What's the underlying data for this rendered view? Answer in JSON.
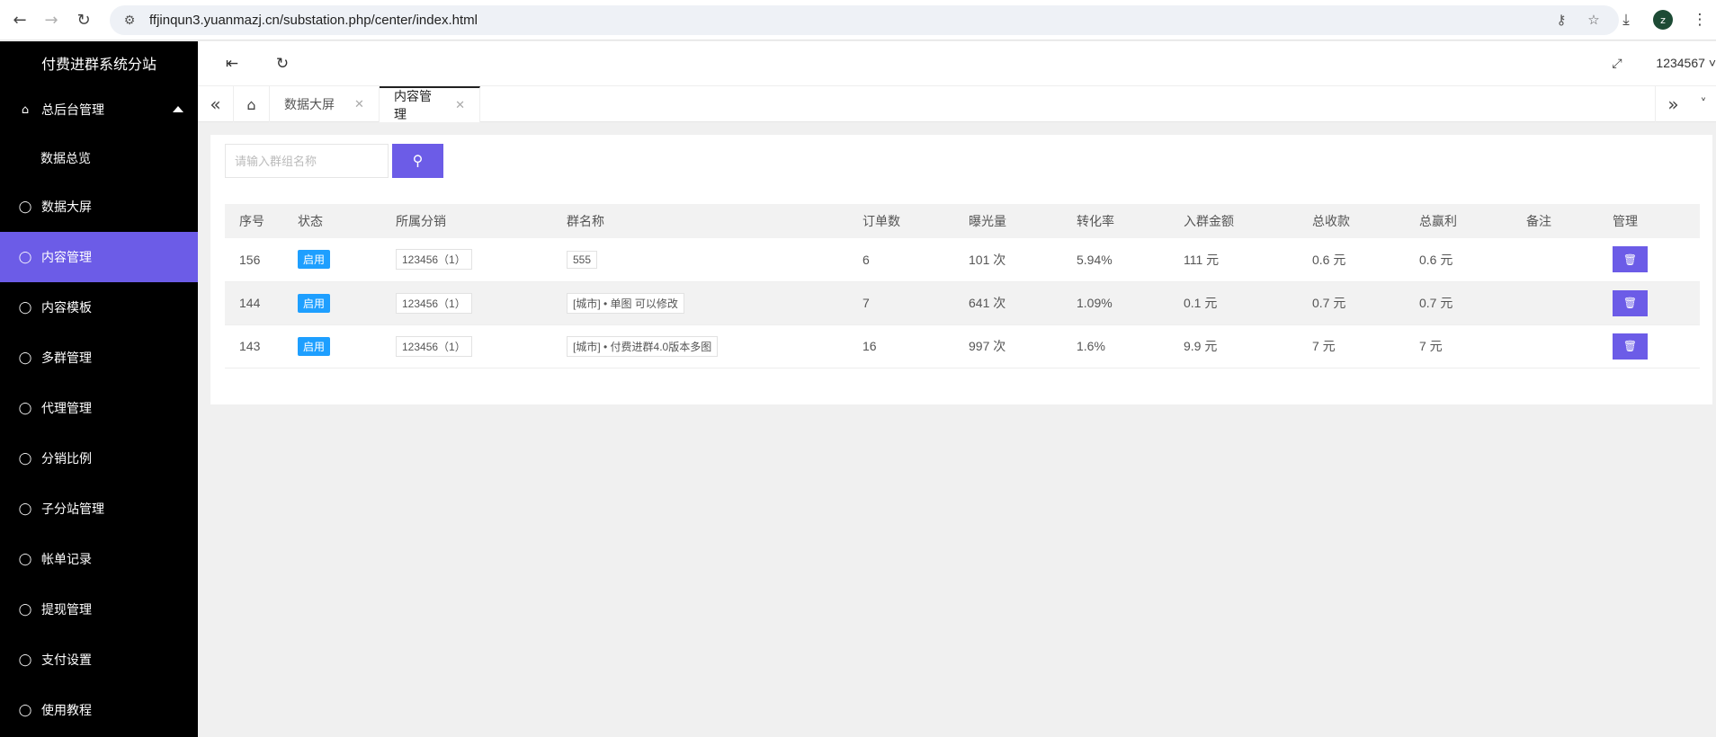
{
  "browser": {
    "url": "ffjinqun3.yuanmazj.cn/substation.php/center/index.html",
    "avatar_letter": "z"
  },
  "sidebar": {
    "brand": "付费进群系统分站",
    "items": [
      {
        "label": "总后台管理",
        "icon": "home-icon",
        "expanded": true
      },
      {
        "label": "数据总览",
        "sub": true
      },
      {
        "label": "数据大屏",
        "icon": "shield-icon"
      },
      {
        "label": "内容管理",
        "icon": "shield-icon",
        "active": true
      },
      {
        "label": "内容模板",
        "icon": "shield-icon"
      },
      {
        "label": "多群管理",
        "icon": "shield-icon"
      },
      {
        "label": "代理管理",
        "icon": "shield-icon"
      },
      {
        "label": "分销比例",
        "icon": "shield-icon"
      },
      {
        "label": "子分站管理",
        "icon": "shield-icon"
      },
      {
        "label": "帐单记录",
        "icon": "shield-icon"
      },
      {
        "label": "提现管理",
        "icon": "shield-icon"
      },
      {
        "label": "支付设置",
        "icon": "shield-icon"
      },
      {
        "label": "使用教程",
        "icon": "shield-icon"
      }
    ]
  },
  "header": {
    "user": "1234567"
  },
  "tabs": [
    {
      "label": "数据大屏"
    },
    {
      "label": "内容管理",
      "active": true
    }
  ],
  "search": {
    "placeholder": "请输入群组名称"
  },
  "table": {
    "columns": [
      "序号",
      "状态",
      "所属分销",
      "群名称",
      "订单数",
      "曝光量",
      "转化率",
      "入群金额",
      "总收款",
      "总赢利",
      "备注",
      "管理"
    ],
    "rows": [
      {
        "id": "156",
        "status": "启用",
        "distributor": "123456（1）",
        "group_name": "555",
        "orders": "6",
        "views": "101 次",
        "conversion": "5.94%",
        "entry_fee": "111 元",
        "total_received": "0.6 元",
        "total_profit": "0.6 元",
        "remark": ""
      },
      {
        "id": "144",
        "status": "启用",
        "distributor": "123456（1）",
        "group_name": "[城市] • 单图 可以修改",
        "orders": "7",
        "views": "641 次",
        "conversion": "1.09%",
        "entry_fee": "0.1 元",
        "total_received": "0.7 元",
        "total_profit": "0.7 元",
        "remark": ""
      },
      {
        "id": "143",
        "status": "启用",
        "distributor": "123456（1）",
        "group_name": "[城市] • 付费进群4.0版本多图",
        "orders": "16",
        "views": "997 次",
        "conversion": "1.6%",
        "entry_fee": "9.9 元",
        "total_received": "7 元",
        "total_profit": "7 元",
        "remark": ""
      }
    ]
  },
  "colors": {
    "accent": "#6c5ce7",
    "status_badge": "#1e9fff",
    "sidebar_bg": "#000000"
  }
}
